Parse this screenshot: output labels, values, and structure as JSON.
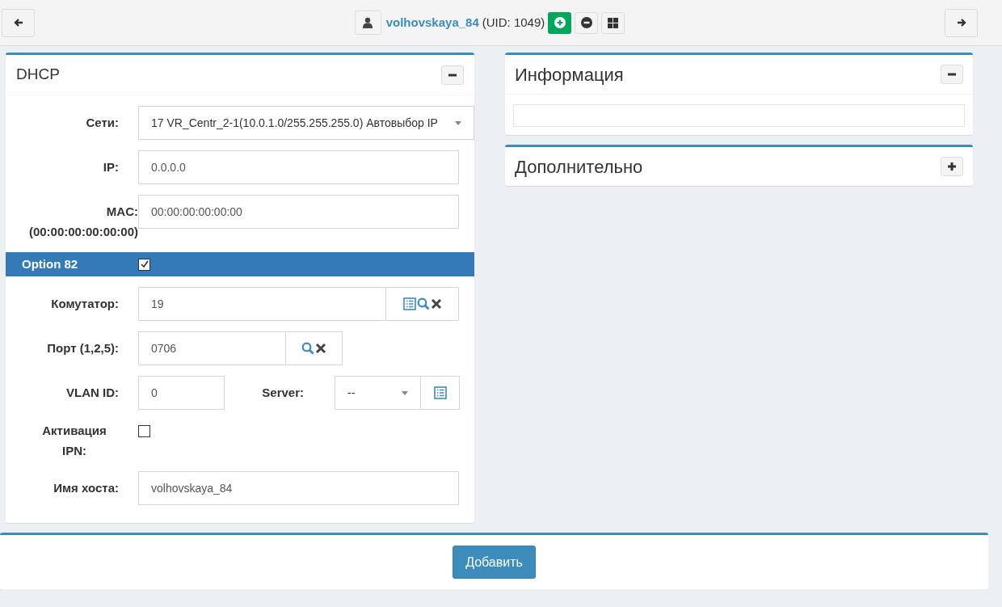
{
  "header": {
    "user_name": "volhovskaya_84",
    "uid": "(UID: 1049)"
  },
  "dhcp": {
    "title": "DHCP",
    "collapsed": false,
    "fields": [
      {
        "kind": "select",
        "label": "Сети:",
        "value": "17 VR_Centr_2-1(10.0.1.0/255.255.255.0) Автовыбор IP"
      },
      {
        "kind": "input",
        "label": "IP:",
        "value": "0.0.0.0"
      },
      {
        "kind": "input",
        "label": "MAC:",
        "sublabel": "(00:00:00:00:00:00)",
        "value": "00:00:00:00:00:00"
      },
      {
        "kind": "banner",
        "label": "Option 82",
        "checked": true
      },
      {
        "kind": "group",
        "label": "Комутатор:",
        "value": "19",
        "addons": [
          {
            "kind": "list"
          },
          {
            "kind": "search"
          },
          {
            "kind": "clear"
          }
        ]
      },
      {
        "kind": "group",
        "label": "Порт (1,2,5):",
        "value": "0706",
        "addons": [
          {
            "kind": "search"
          },
          {
            "kind": "clear"
          }
        ]
      },
      {
        "kind": "vlan",
        "label": "VLAN ID:",
        "value": "0",
        "server_label": "Server:",
        "server_value": "--"
      },
      {
        "kind": "checkbox",
        "label": "Активация IPN:",
        "checked": false
      },
      {
        "kind": "input",
        "label": "Имя хоста:",
        "value": "volhovskaya_84"
      }
    ]
  },
  "side_panels": [
    {
      "title": "Информация",
      "collapsed": false
    },
    {
      "title": "Дополнительно",
      "collapsed": true
    }
  ],
  "submit_button": "Добавить"
}
